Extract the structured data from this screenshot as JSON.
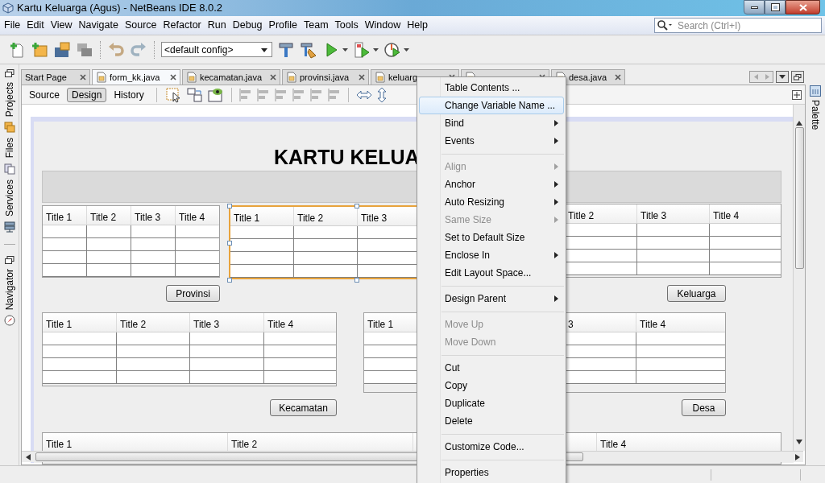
{
  "window": {
    "title": "Kartu Keluarga (Agus) - NetBeans IDE 8.0.2"
  },
  "menu_bar": [
    "File",
    "Edit",
    "View",
    "Navigate",
    "Source",
    "Refactor",
    "Run",
    "Debug",
    "Profile",
    "Team",
    "Tools",
    "Window",
    "Help"
  ],
  "search": {
    "placeholder": "Search (Ctrl+I)"
  },
  "toolbar": {
    "config": "<default config>"
  },
  "left_panels": [
    {
      "label": "Projects"
    },
    {
      "label": "Files"
    },
    {
      "label": "Services"
    },
    {
      "label": "Navigator"
    }
  ],
  "right_panels": [
    {
      "label": "Palette"
    }
  ],
  "editor_tabs": [
    {
      "label": "Start Page",
      "kind": "page",
      "selected": false
    },
    {
      "label": "form_kk.java",
      "kind": "form",
      "selected": true
    },
    {
      "label": "kecamatan.java",
      "kind": "form",
      "selected": false
    },
    {
      "label": "provinsi.java",
      "kind": "form",
      "selected": false
    },
    {
      "label": "keluarg",
      "kind": "form",
      "selected": false
    },
    {
      "kind": "form",
      "selected": false
    },
    {
      "label": "desa.java",
      "kind": "form",
      "selected": false
    }
  ],
  "view_tabs": [
    {
      "label": "Source",
      "selected": false
    },
    {
      "label": "Design",
      "selected": true
    },
    {
      "label": "History",
      "selected": false
    }
  ],
  "form": {
    "heading": "KARTU KELUA",
    "tables": [
      {
        "columns": [
          "Title 1",
          "Title 2",
          "Title 3",
          "Title 4"
        ],
        "selected": false
      },
      {
        "columns": [
          "Title 1",
          "Title 2",
          "Title 3"
        ],
        "selected": true
      },
      {
        "columns": [
          "Title 2",
          "Title 3",
          "Title 4"
        ],
        "selected": false
      },
      {
        "columns": [
          "Title 1",
          "Title 2",
          "Title 3",
          "Title 4"
        ],
        "selected": false
      },
      {
        "columns": [
          "Title 1",
          "3",
          "Title 4"
        ],
        "selected": false
      },
      {
        "columns": [
          "Title 1",
          "Title 2",
          "Title 4"
        ],
        "selected": false
      }
    ],
    "buttons": [
      "Provinsi",
      "Keluarga",
      "Kecamatan",
      "Desa"
    ]
  },
  "context_menu": [
    {
      "kind": "item",
      "label": "Table Contents ...",
      "submenu": false,
      "disabled": false,
      "selected": false
    },
    {
      "kind": "item",
      "label": "Change Variable Name ...",
      "submenu": false,
      "disabled": false,
      "selected": true
    },
    {
      "kind": "item",
      "label": "Bind",
      "submenu": true,
      "disabled": false,
      "selected": false
    },
    {
      "kind": "item",
      "label": "Events",
      "submenu": true,
      "disabled": false,
      "selected": false
    },
    {
      "kind": "separator"
    },
    {
      "kind": "item",
      "label": "Align",
      "submenu": true,
      "disabled": true,
      "selected": false
    },
    {
      "kind": "item",
      "label": "Anchor",
      "submenu": true,
      "disabled": false,
      "selected": false
    },
    {
      "kind": "item",
      "label": "Auto Resizing",
      "submenu": true,
      "disabled": false,
      "selected": false
    },
    {
      "kind": "item",
      "label": "Same Size",
      "submenu": true,
      "disabled": true,
      "selected": false
    },
    {
      "kind": "item",
      "label": "Set to Default Size",
      "submenu": false,
      "disabled": false,
      "selected": false
    },
    {
      "kind": "item",
      "label": "Enclose In",
      "submenu": true,
      "disabled": false,
      "selected": false
    },
    {
      "kind": "item",
      "label": "Edit Layout Space...",
      "submenu": false,
      "disabled": false,
      "selected": false
    },
    {
      "kind": "separator"
    },
    {
      "kind": "item",
      "label": "Design Parent",
      "submenu": true,
      "disabled": false,
      "selected": false
    },
    {
      "kind": "separator"
    },
    {
      "kind": "item",
      "label": "Move Up",
      "submenu": false,
      "disabled": true,
      "selected": false
    },
    {
      "kind": "item",
      "label": "Move Down",
      "submenu": false,
      "disabled": true,
      "selected": false
    },
    {
      "kind": "separator"
    },
    {
      "kind": "item",
      "label": "Cut",
      "submenu": false,
      "disabled": false,
      "selected": false
    },
    {
      "kind": "item",
      "label": "Copy",
      "submenu": false,
      "disabled": false,
      "selected": false
    },
    {
      "kind": "item",
      "label": "Duplicate",
      "submenu": false,
      "disabled": false,
      "selected": false
    },
    {
      "kind": "item",
      "label": "Delete",
      "submenu": false,
      "disabled": false,
      "selected": false
    },
    {
      "kind": "separator"
    },
    {
      "kind": "item",
      "label": "Customize Code...",
      "submenu": false,
      "disabled": false,
      "selected": false
    },
    {
      "kind": "separator"
    },
    {
      "kind": "item",
      "label": "Properties",
      "submenu": false,
      "disabled": false,
      "selected": false
    }
  ]
}
